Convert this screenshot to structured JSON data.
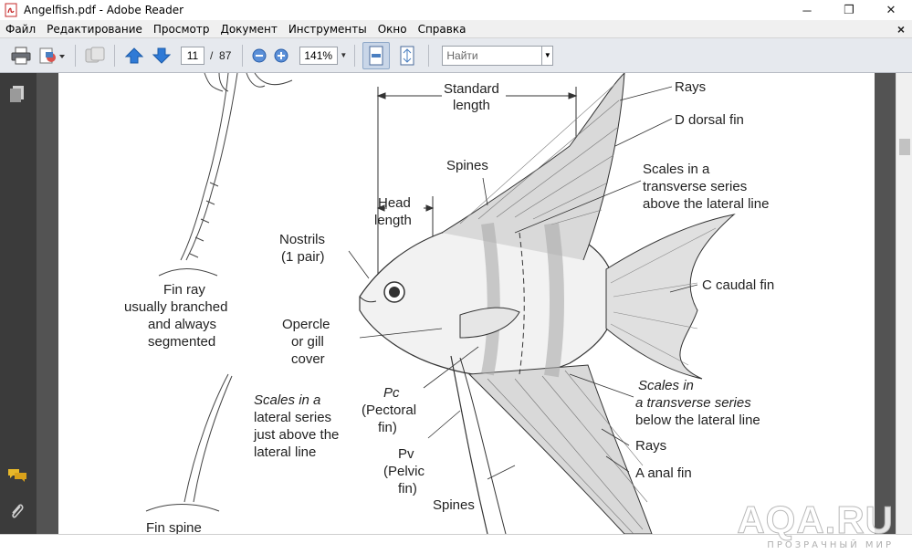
{
  "window": {
    "title": "Angelfish.pdf - Adobe Reader",
    "minimize_glyph": "─",
    "restore_glyph": "❐",
    "close_glyph": "✕"
  },
  "menu": {
    "items": [
      "Файл",
      "Редактирование",
      "Просмотр",
      "Документ",
      "Инструменты",
      "Окно",
      "Справка"
    ],
    "close_glyph": "×"
  },
  "toolbar": {
    "current_page": "11",
    "page_separator": "/",
    "total_pages": "87",
    "zoom": "141%",
    "find_placeholder": "Найти"
  },
  "icons": {
    "print": "printer-icon",
    "create": "create-pdf-icon",
    "collaborate": "share-icon",
    "prev_page": "arrow-up-icon",
    "next_page": "arrow-down-icon",
    "zoom_out": "zoom-out-icon",
    "zoom_in": "zoom-in-icon",
    "fit_width": "fit-width-icon",
    "fit_page": "fit-page-icon",
    "pages_panel": "pages-icon",
    "comments": "comments-icon",
    "attachments": "paperclip-icon"
  },
  "colors": {
    "toolbar_bg": "#e6e9ee",
    "left_nav_bg": "#3b3b3b",
    "doc_bg": "#535353",
    "arrow_blue": "#2f7ad6",
    "comment_yellow": "#e8b82a"
  },
  "diagram": {
    "labels": {
      "standard_length_1": "Standard",
      "standard_length_2": "length",
      "rays_top": "Rays",
      "dorsal_fin": "D dorsal fin",
      "spines_top": "Spines",
      "scales_above_1": "Scales in a",
      "scales_above_2": "transverse series",
      "scales_above_3": "above the lateral line",
      "head_length_1": "Head",
      "head_length_2": "length",
      "nostrils_1": "Nostrils",
      "nostrils_2": "(1 pair)",
      "caudal_fin": "C caudal fin",
      "fin_ray_1": "Fin ray",
      "fin_ray_2": "usually branched",
      "fin_ray_3": "and always",
      "fin_ray_4": "segmented",
      "opercle_1": "Opercle",
      "opercle_2": "or gill",
      "opercle_3": "cover",
      "scales_below_1": "Scales in",
      "scales_below_2": "a transverse series",
      "scales_below_3": "below the lateral line",
      "scales_lateral_1": "Scales in a",
      "scales_lateral_2": "lateral series",
      "scales_lateral_3": "just above the",
      "scales_lateral_4": "lateral line",
      "pectoral_1": "Pc",
      "pectoral_2": "(Pectoral",
      "pectoral_3": "fin)",
      "rays_bottom": "Rays",
      "pelvic_1": "Pv",
      "pelvic_2": "(Pelvic",
      "pelvic_3": "fin)",
      "anal_fin": "A anal fin",
      "spines_bottom": "Spines",
      "fin_spine": "Fin spine"
    }
  },
  "watermark": {
    "main": "AQA.RU",
    "sub": "ПРОЗРАЧНЫЙ МИР"
  }
}
